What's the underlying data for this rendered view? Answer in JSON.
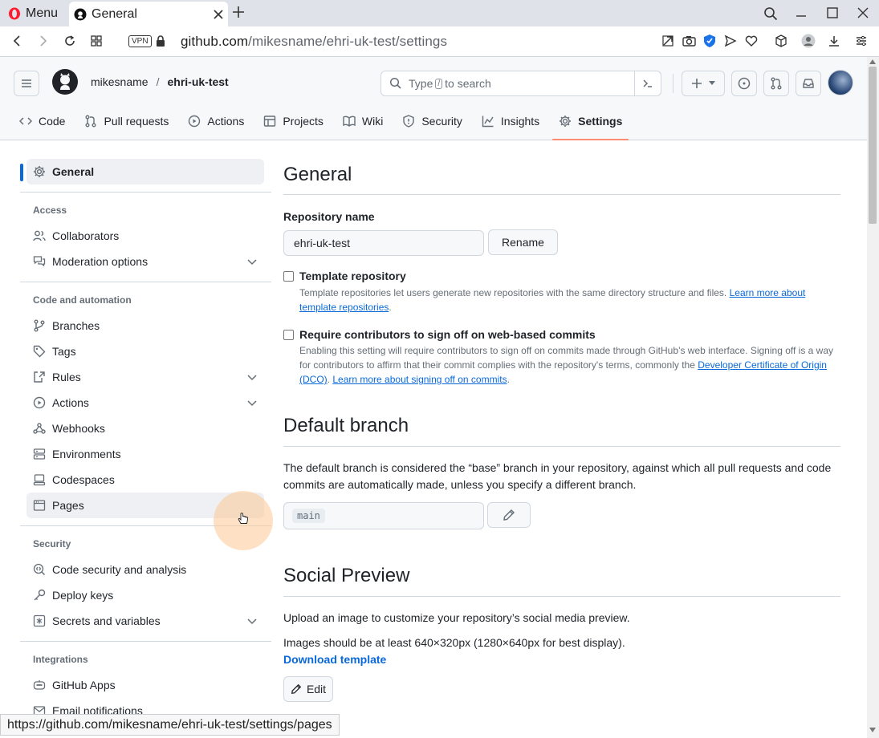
{
  "browser": {
    "menu_label": "Menu",
    "tab_title": "General",
    "url_host": "github.com",
    "url_path": "/mikesname/ehri-uk-test/settings",
    "vpn_badge": "VPN",
    "status_url": "https://github.com/mikesname/ehri-uk-test/settings/pages"
  },
  "header": {
    "owner": "mikesname",
    "separator": "/",
    "repo": "ehri-uk-test",
    "search_prefix": "Type",
    "search_key": "/",
    "search_suffix": "to search"
  },
  "repo_nav": [
    {
      "label": "Code",
      "icon": "code-icon"
    },
    {
      "label": "Pull requests",
      "icon": "pull-request-icon"
    },
    {
      "label": "Actions",
      "icon": "play-icon"
    },
    {
      "label": "Projects",
      "icon": "table-icon"
    },
    {
      "label": "Wiki",
      "icon": "book-icon"
    },
    {
      "label": "Security",
      "icon": "shield-icon"
    },
    {
      "label": "Insights",
      "icon": "graph-icon"
    },
    {
      "label": "Settings",
      "icon": "gear-icon",
      "active": true
    }
  ],
  "sidebar": {
    "general": "General",
    "access_heading": "Access",
    "collaborators": "Collaborators",
    "moderation": "Moderation options",
    "code_heading": "Code and automation",
    "branches": "Branches",
    "tags": "Tags",
    "rules": "Rules",
    "actions": "Actions",
    "webhooks": "Webhooks",
    "environments": "Environments",
    "codespaces": "Codespaces",
    "pages": "Pages",
    "security_heading": "Security",
    "code_security": "Code security and analysis",
    "deploy_keys": "Deploy keys",
    "secrets": "Secrets and variables",
    "integrations_heading": "Integrations",
    "github_apps": "GitHub Apps",
    "email_notifications": "Email notifications"
  },
  "main": {
    "general_title": "General",
    "repo_name_label": "Repository name",
    "repo_name_value": "ehri-uk-test",
    "rename_button": "Rename",
    "template_label": "Template repository",
    "template_note": "Template repositories let users generate new repositories with the same directory structure and files. ",
    "template_link": "Learn more about template repositories",
    "signoff_label": "Require contributors to sign off on web-based commits",
    "signoff_note": "Enabling this setting will require contributors to sign off on commits made through GitHub’s web interface. Signing off is a way for contributors to affirm that their commit complies with the repository's terms, commonly the ",
    "signoff_link1": "Developer Certificate of Origin (DCO)",
    "signoff_sep": ". ",
    "signoff_link2": "Learn more about signing off on commits",
    "signoff_end": ".",
    "default_branch_title": "Default branch",
    "default_branch_desc": "The default branch is considered the “base” branch in your repository, against which all pull requests and code commits are automatically made, unless you specify a different branch.",
    "default_branch_value": "main",
    "social_title": "Social Preview",
    "social_desc": "Upload an image to customize your repository’s social media preview.",
    "social_size": "Images should be at least 640×320px (1280×640px for best display).",
    "download_template": "Download template",
    "edit_button": "Edit"
  },
  "colors": {
    "accent": "#0969da",
    "active_underline": "#fd8c73",
    "sidebar_active": "#0969da"
  }
}
